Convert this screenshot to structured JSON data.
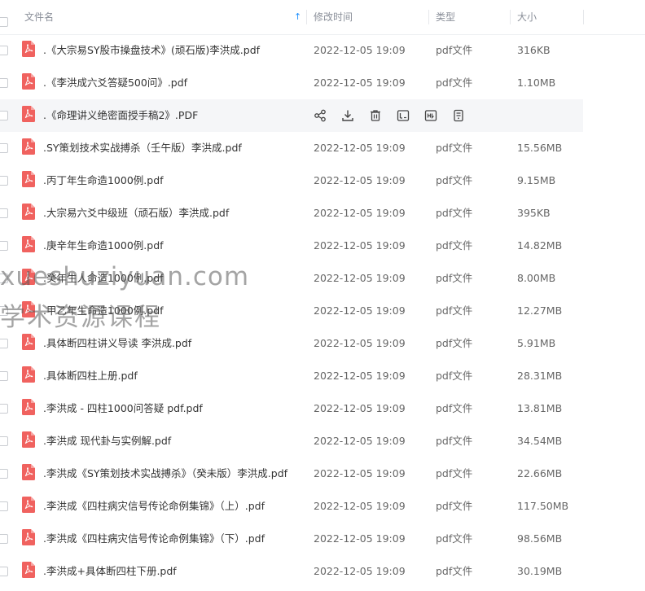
{
  "header": {
    "name_label": "文件名",
    "modified_label": "修改时间",
    "type_label": "类型",
    "size_label": "大小",
    "sort_indicator": "↑"
  },
  "files": [
    {
      "name": ".《大宗易SY股市操盘技术》(顽石版)李洪成.pdf",
      "date": "2022-12-05 19:09",
      "type": "pdf文件",
      "size": "316KB"
    },
    {
      "name": ".《李洪成六爻答疑500问》.pdf",
      "date": "2022-12-05 19:09",
      "type": "pdf文件",
      "size": "1.10MB"
    },
    {
      "name": ".《命理讲义绝密面授手稿2》.PDF",
      "date": "",
      "type": "",
      "size": "",
      "hovered": true
    },
    {
      "name": ".SY策划技术实战搏杀（壬午版）李洪成.pdf",
      "date": "2022-12-05 19:09",
      "type": "pdf文件",
      "size": "15.56MB"
    },
    {
      "name": ".丙丁年生命造1000例.pdf",
      "date": "2022-12-05 19:09",
      "type": "pdf文件",
      "size": "9.15MB"
    },
    {
      "name": ".大宗易六爻中级班（顽石版）李洪成.pdf",
      "date": "2022-12-05 19:09",
      "type": "pdf文件",
      "size": "395KB"
    },
    {
      "name": ".庚辛年生命造1000例.pdf",
      "date": "2022-12-05 19:09",
      "type": "pdf文件",
      "size": "14.82MB"
    },
    {
      "name": ".癸年生人命造1000例.pdf",
      "date": "2022-12-05 19:09",
      "type": "pdf文件",
      "size": "8.00MB"
    },
    {
      "name": ".甲乙年生命造1000例.pdf",
      "date": "2022-12-05 19:09",
      "type": "pdf文件",
      "size": "12.27MB"
    },
    {
      "name": ".具体断四柱讲义导读 李洪成.pdf",
      "date": "2022-12-05 19:09",
      "type": "pdf文件",
      "size": "5.91MB"
    },
    {
      "name": ".具体断四柱上册.pdf",
      "date": "2022-12-05 19:09",
      "type": "pdf文件",
      "size": "28.31MB"
    },
    {
      "name": ".李洪成 - 四柱1000问答疑 pdf.pdf",
      "date": "2022-12-05 19:09",
      "type": "pdf文件",
      "size": "13.81MB"
    },
    {
      "name": ".李洪成 现代卦与实例解.pdf",
      "date": "2022-12-05 19:09",
      "type": "pdf文件",
      "size": "34.54MB"
    },
    {
      "name": ".李洪成《SY策划技术实战搏杀》（癸未版）李洪成.pdf",
      "date": "2022-12-05 19:09",
      "type": "pdf文件",
      "size": "22.66MB"
    },
    {
      "name": ".李洪成《四柱病灾信号传论命例集锦》（上）.pdf",
      "date": "2022-12-05 19:09",
      "type": "pdf文件",
      "size": "117.50MB"
    },
    {
      "name": ".李洪成《四柱病灾信号传论命例集锦》（下）.pdf",
      "date": "2022-12-05 19:09",
      "type": "pdf文件",
      "size": "98.56MB"
    },
    {
      "name": ".李洪成+具体断四柱下册.pdf",
      "date": "2022-12-05 19:09",
      "type": "pdf文件",
      "size": "30.19MB"
    }
  ],
  "row_actions": [
    "share-icon",
    "download-icon",
    "delete-icon",
    "rename-icon",
    "move-icon",
    "more-icon"
  ],
  "watermark": {
    "line1": "xueshuziyuan.com",
    "line2": "学术资源课程"
  },
  "colors": {
    "pdf_icon": "#f0625f",
    "sort_accent": "#1e90ff",
    "hover_row": "#f5f6f8"
  }
}
